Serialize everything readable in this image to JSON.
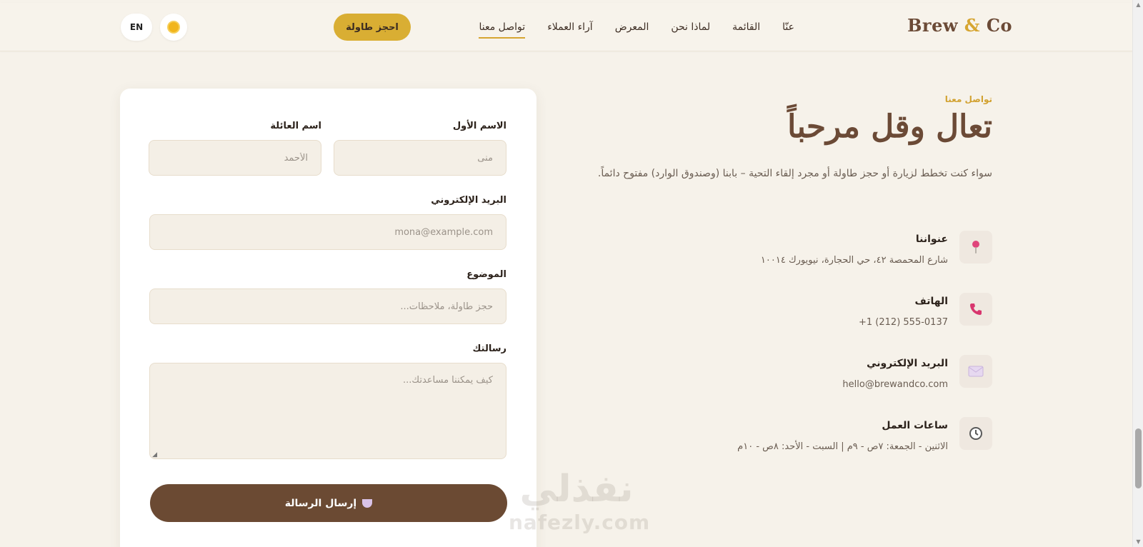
{
  "header": {
    "brand_main": "Brew",
    "brand_amp": "&",
    "brand_end": "Co",
    "nav": [
      {
        "label": "عنّا"
      },
      {
        "label": "القائمة"
      },
      {
        "label": "لماذا نحن"
      },
      {
        "label": "المعرض"
      },
      {
        "label": "آراء العملاء"
      },
      {
        "label": "تواصل معنا",
        "active": true
      }
    ],
    "book_label": "احجز طاولة",
    "lang_label": "EN"
  },
  "contact": {
    "eyebrow": "تواصل معنا",
    "title": "تعال وقل مرحباً",
    "lead": "سواء كنت تخطط لزيارة أو حجز طاولة أو مجرد إلقاء التحية – بابنا (وصندوق الوارد) مفتوح دائماً.",
    "items": [
      {
        "title": "عنواننا",
        "value": "شارع المحمصة ٤٢، حي الحجارة، نيويورك ١٠٠١٤",
        "icon": "pin-icon"
      },
      {
        "title": "الهاتف",
        "value": "+1 (212) 555-0137",
        "icon": "phone-icon"
      },
      {
        "title": "البريد الإلكتروني",
        "value": "hello@brewandco.com",
        "icon": "mail-icon"
      },
      {
        "title": "ساعات العمل",
        "value": "الاثنين - الجمعة: ٧ص - ٩م | السبت - الأحد: ٨ص - ١٠م",
        "icon": "clock-icon"
      }
    ]
  },
  "form": {
    "first_name_label": "الاسم الأول",
    "first_name_placeholder": "منى",
    "last_name_label": "اسم العائلة",
    "last_name_placeholder": "الأحمد",
    "email_label": "البريد الإلكتروني",
    "email_placeholder": "mona@example.com",
    "subject_label": "الموضوع",
    "subject_placeholder": "حجز طاولة، ملاحظات...",
    "message_label": "رسالتك",
    "message_placeholder": "كيف يمكننا مساعدتك...",
    "send_label": "إرسال الرسالة"
  },
  "watermark": {
    "arabic": "نفذلي",
    "latin": "nafezly.com"
  }
}
